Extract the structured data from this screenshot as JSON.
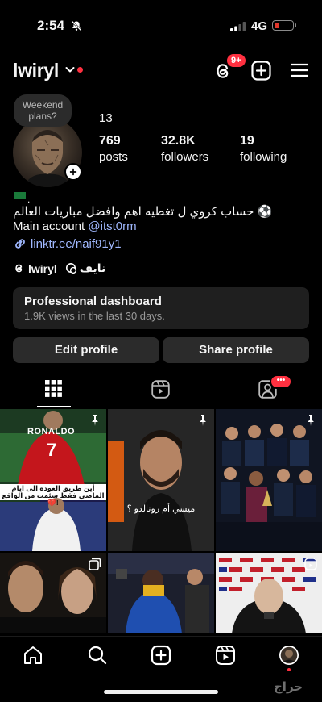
{
  "status_bar": {
    "time": "2:54",
    "network": "4G",
    "battery_percent": 15
  },
  "header": {
    "username": "lwiryl",
    "threads_badge": "9+"
  },
  "profile": {
    "note": "Weekend plans?",
    "count_above": "13",
    "stats": [
      {
        "value": "769",
        "label": "posts"
      },
      {
        "value": "32.8K",
        "label": "followers"
      },
      {
        "value": "19",
        "label": "following"
      }
    ],
    "flag_dot": ".",
    "bio_line1": "حساب كروي ل تغطيه اهم وافضل مباريات العالم ⚽",
    "bio_line2_prefix": "Main account ",
    "bio_line2_mention": "@itst0rm",
    "link": "linktr.ee/naif91y1",
    "threads_name": "lwiryl",
    "other_name": "نايف"
  },
  "dashboard": {
    "title": "Professional dashboard",
    "subtitle": "1.9K views in the last 30 days."
  },
  "buttons": {
    "edit": "Edit profile",
    "share": "Share profile"
  },
  "tabs": [
    "grid",
    "reels",
    "tagged"
  ],
  "tagged_badge": "•••",
  "posts": [
    {
      "jersey": "RONALDO",
      "number": "7",
      "caption": "أين طريق العودة الى ايام الماضي فقط سئمت من الواقع 💔!",
      "pinned": true
    },
    {
      "caption": "ميسي أم رونالدو ؟",
      "pinned": true
    },
    {
      "pinned": true
    },
    {
      "carousel": true
    },
    {
      "carousel": false
    },
    {
      "reel": true
    }
  ],
  "watermark": "حراج"
}
